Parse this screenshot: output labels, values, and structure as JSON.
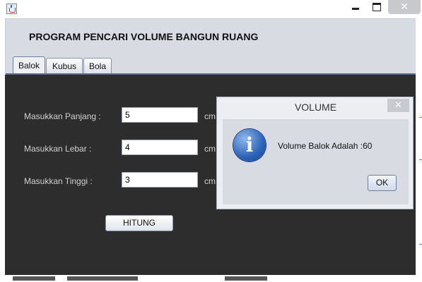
{
  "window": {
    "app_icon": "java-cup-icon",
    "min_icon": "minimize-icon",
    "max_icon": "maximize-icon",
    "close_icon": "close-icon"
  },
  "header": {
    "title": "PROGRAM PENCARI VOLUME BANGUN RUANG"
  },
  "tabs": [
    {
      "label": "Balok",
      "active": true
    },
    {
      "label": "Kubus",
      "active": false
    },
    {
      "label": "Bola",
      "active": false
    }
  ],
  "form": {
    "fields": [
      {
        "label": "Masukkan Panjang  :",
        "value": "5",
        "unit": "cm"
      },
      {
        "label": "Masukkan Lebar     :",
        "value": "4",
        "unit": "cm"
      },
      {
        "label": "Masukkan Tinggi    :",
        "value": "3",
        "unit": "cm"
      }
    ],
    "button_label": "HITUNG"
  },
  "dialog": {
    "title": "VOLUME",
    "message": "Volume Balok Adalah :60",
    "ok_label": "OK",
    "icon": "info-icon",
    "colors": {
      "icon": "#2d63b7"
    }
  },
  "colors": {
    "panel_bg": "#2d2d2d",
    "content_bg": "#d9dbe3",
    "tab_line": "#5c6d93"
  }
}
